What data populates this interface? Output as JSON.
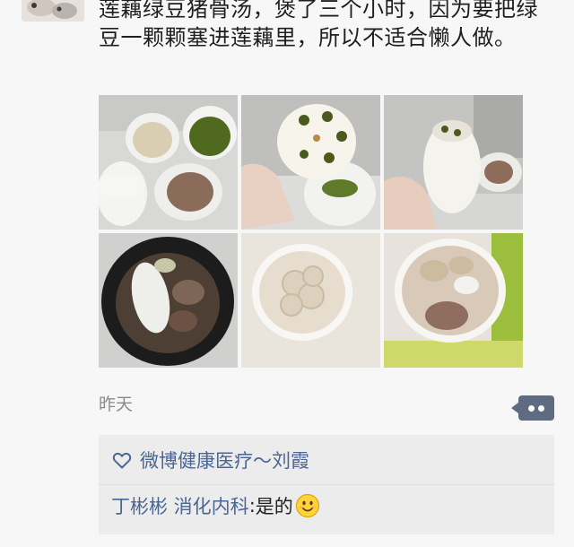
{
  "post": {
    "text": "莲藕绿豆猪骨汤，煲了三个小时，因为要把绿豆一颗颗塞进莲藕里，所以不适合懒人做。",
    "photos": [
      {
        "name": "photo-ingredients"
      },
      {
        "name": "photo-lotus-root-held"
      },
      {
        "name": "photo-lotus-root-stuffed"
      },
      {
        "name": "photo-slow-cooker-pot"
      },
      {
        "name": "photo-bowl-lotus-slices"
      },
      {
        "name": "photo-bowl-soup-pork"
      }
    ],
    "time": "昨天"
  },
  "icons": {
    "comment": "comment-icon",
    "like": "heart-icon",
    "emoji": "smiley-icon"
  },
  "feedback": {
    "likes": "微博健康医疗～刘霞",
    "comment": {
      "author": "丁彬彬 消化内科",
      "separator": ": ",
      "text": "是的"
    }
  },
  "colors": {
    "link": "#4a6693",
    "comment_button": "#5e6b80",
    "feedback_bg": "#ececec"
  }
}
